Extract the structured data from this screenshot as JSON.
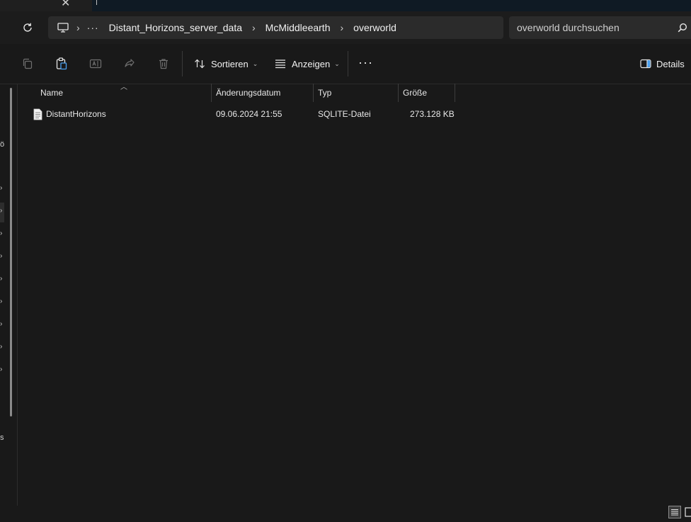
{
  "window": {
    "tab_close": "✕"
  },
  "address": {
    "breadcrumb_more": "···",
    "breadcrumb": [
      "Distant_Horizons_server_data",
      "McMiddleearth",
      "overworld"
    ],
    "separator": "›"
  },
  "search": {
    "placeholder": "overworld durchsuchen"
  },
  "toolbar": {
    "sort_label": "Sortieren",
    "view_label": "Anzeigen",
    "more_label": "···",
    "details_label": "Details"
  },
  "nav_fragments": {
    "top_char": "ö",
    "bottom_char": "s"
  },
  "columns": {
    "name": "Name",
    "modified": "Änderungsdatum",
    "type": "Typ",
    "size": "Größe"
  },
  "files": [
    {
      "name": "DistantHorizons",
      "modified": "09.06.2024 21:55",
      "type": "SQLITE-Datei",
      "size": "273.128 KB"
    }
  ],
  "icons": {
    "refresh": "refresh-icon",
    "pc": "computer-icon",
    "search": "search-icon",
    "copy": "copy-icon",
    "paste": "paste-icon",
    "rename": "rename-icon",
    "share": "share-icon",
    "delete": "delete-icon",
    "sort": "sort-icon",
    "view": "view-icon",
    "details": "details-pane-icon",
    "file": "file-icon"
  },
  "colors": {
    "background": "#191919",
    "address_bar": "#2b2b2b",
    "text": "#ffffff",
    "muted": "#6f6f6f"
  }
}
